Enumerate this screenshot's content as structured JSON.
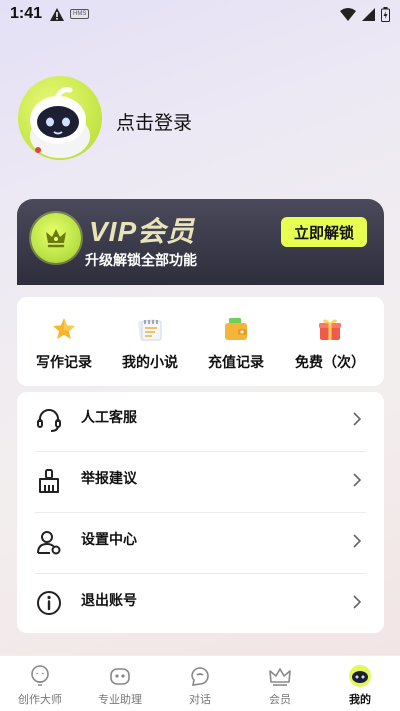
{
  "status_bar": {
    "time": "1:41",
    "badge": "HMS"
  },
  "profile": {
    "login_text": "点击登录"
  },
  "vip": {
    "title": "VIP会员",
    "subtitle": "升级解锁全部功能",
    "unlock_label": "立即解锁",
    "accent": "#e6ff50"
  },
  "quick_actions": [
    {
      "label": "写作记录",
      "icon": "star-icon"
    },
    {
      "label": "我的小说",
      "icon": "notebook-icon"
    },
    {
      "label": "充值记录",
      "icon": "wallet-icon"
    },
    {
      "label": "免费（次）",
      "icon": "gift-icon"
    }
  ],
  "menu": [
    {
      "label": "人工客服",
      "icon": "headset-icon"
    },
    {
      "label": "举报建议",
      "icon": "broom-icon"
    },
    {
      "label": "设置中心",
      "icon": "user-settings-icon"
    },
    {
      "label": "退出账号",
      "icon": "info-icon"
    }
  ],
  "tabs": [
    {
      "label": "创作大师",
      "icon": "bulb-icon"
    },
    {
      "label": "专业助理",
      "icon": "robot-icon"
    },
    {
      "label": "对话",
      "icon": "chat-icon"
    },
    {
      "label": "会员",
      "icon": "crown-icon"
    },
    {
      "label": "我的",
      "icon": "mascot-icon",
      "active": true
    }
  ]
}
